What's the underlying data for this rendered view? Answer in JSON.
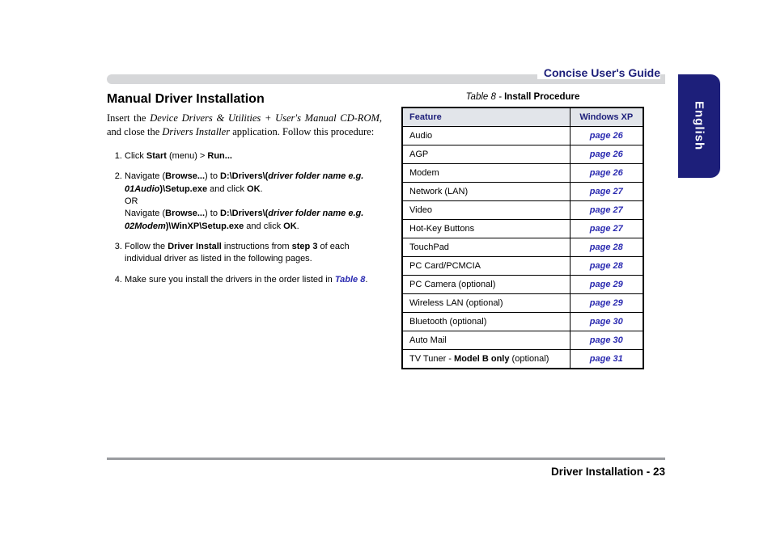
{
  "header": {
    "guide_title": "Concise User's Guide"
  },
  "sidetab": {
    "language": "English"
  },
  "left": {
    "section_title": "Manual Driver Installation",
    "intro_pre": "Insert the ",
    "intro_ital1": "Device Drivers & Utilities + User's Manual CD-ROM",
    "intro_mid": ", and close the ",
    "intro_ital2": "Drivers Installer",
    "intro_post": " application. Follow this procedure:",
    "step1_a": "Click ",
    "step1_b": "Start",
    "step1_c": " (menu) > ",
    "step1_d": "Run...",
    "step2_a": "Navigate (",
    "step2_b": "Browse...",
    "step2_c": ") to ",
    "step2_d": "D:\\Drivers\\(",
    "step2_e": "driver folder name e.g. 01Audio",
    "step2_f": ")\\Setup.exe",
    "step2_g": " and click ",
    "step2_h": "OK",
    "step2_or": "OR",
    "step2_i": "Navigate (",
    "step2_j": "Browse...",
    "step2_k": ") to ",
    "step2_l": "D:\\Drivers\\(",
    "step2_m": "driver folder name e.g. 02Modem",
    "step2_n": ")\\WinXP\\Setup.exe",
    "step2_o": " and click ",
    "step2_p": "OK",
    "step3_a": "Follow the ",
    "step3_b": "Driver Install",
    "step3_c": " instructions from ",
    "step3_d": "step 3",
    "step3_e": " of each individual driver as listed in the following pages.",
    "step4_a": "Make sure you install the drivers in the order listed in ",
    "step4_b": "Table 8",
    "step4_c": "."
  },
  "table": {
    "caption_num": "Table 8 -",
    "caption_name": " Install Procedure",
    "col_feature": "Feature",
    "col_winxp": "Windows XP",
    "rows": [
      {
        "feature": "Audio",
        "page": "page 26"
      },
      {
        "feature": "AGP",
        "page": "page 26"
      },
      {
        "feature": "Modem",
        "page": "page 26"
      },
      {
        "feature": "Network (LAN)",
        "page": "page 27"
      },
      {
        "feature": "Video",
        "page": "page 27"
      },
      {
        "feature": "Hot-Key Buttons",
        "page": "page 27"
      },
      {
        "feature": "TouchPad",
        "page": "page 28"
      },
      {
        "feature": "PC Card/PCMCIA",
        "page": "page 28"
      },
      {
        "feature": "PC Camera (optional)",
        "page": "page 29"
      },
      {
        "feature": "Wireless LAN (optional)",
        "page": "page 29"
      },
      {
        "feature": "Bluetooth (optional)",
        "page": "page 30"
      },
      {
        "feature": "Auto Mail",
        "page": "page 30"
      }
    ],
    "last_row_a": "TV Tuner - ",
    "last_row_b": "Model B only",
    "last_row_c": " (optional)",
    "last_row_page": "page 31"
  },
  "footer": {
    "text": "Driver Installation - 23"
  }
}
